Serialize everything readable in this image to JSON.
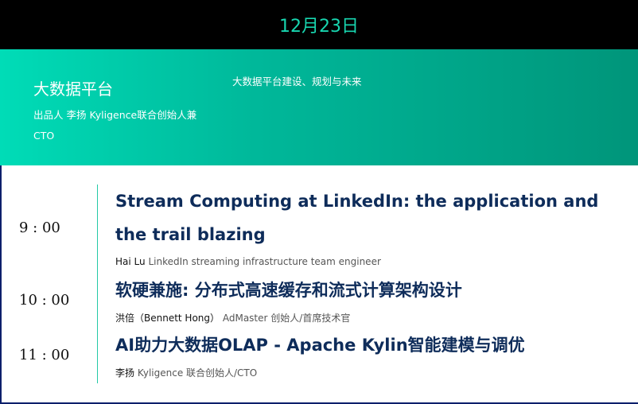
{
  "header": {
    "date": "12月23日"
  },
  "track": {
    "title": "大数据平台",
    "producer": "出品人 李扬 Kyligence联合创始人兼CTO",
    "description": "大数据平台建设、规划与未来"
  },
  "sessions": [
    {
      "time": "9 : 00",
      "title": "Stream Computing at LinkedIn: the application and the trail blazing",
      "speaker_name": "Hai Lu",
      "speaker_role": "LinkedIn streaming infrastructure team engineer"
    },
    {
      "time": "10 : 00",
      "title": "软硬兼施: 分布式高速缓存和流式计算架构设计",
      "speaker_name": "洪倍（Bennett Hong）",
      "speaker_role": "AdMaster 创始人/首席技术官"
    },
    {
      "time": "11 : 00",
      "title": "AI助力大数据OLAP - Apache Kylin智能建模与调优",
      "speaker_name": "李扬",
      "speaker_role": "Kyligence 联合创始人/CTO"
    }
  ],
  "colors": {
    "date_text": "#18d6b0",
    "banner_start": "#00dcb7",
    "banner_end": "#00957a",
    "session_title": "#0e2c5a",
    "timeline": "#23c9a6"
  }
}
